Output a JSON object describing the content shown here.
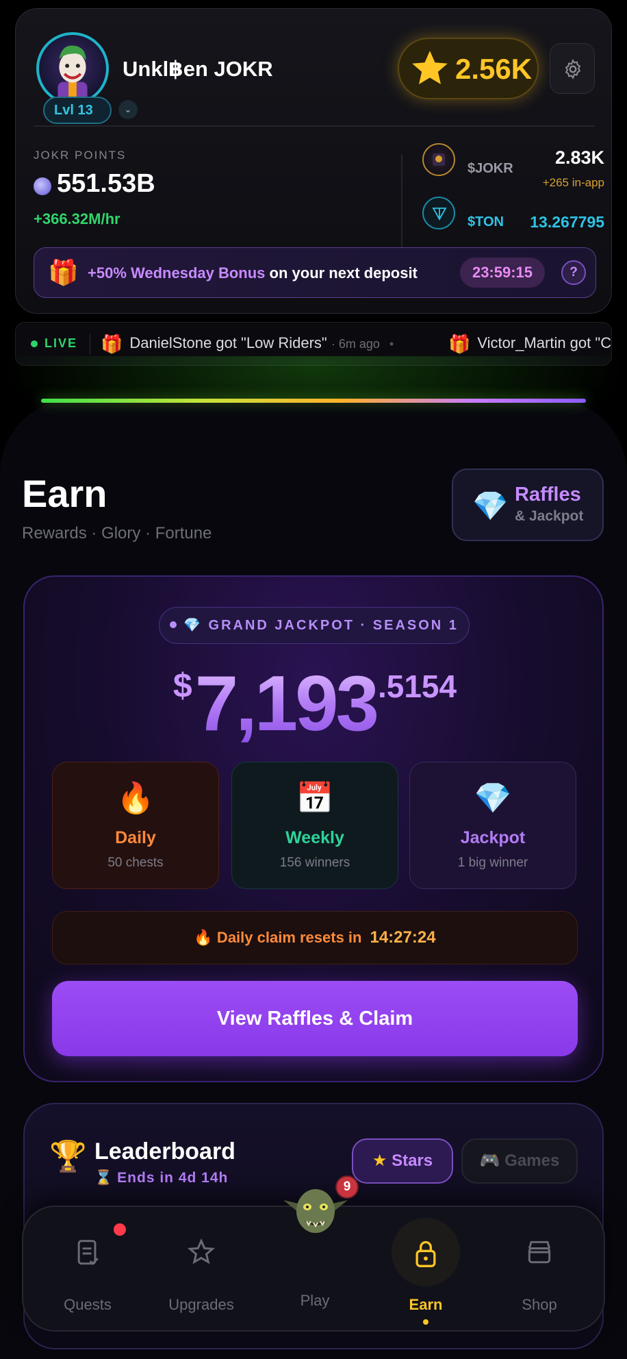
{
  "profile": {
    "username": "Unkl฿en JOKR",
    "level": "Lvl 13",
    "stars_balance": "2.56K"
  },
  "points": {
    "label": "JOKR POINTS",
    "value": "551.53B",
    "rate": "+366.32M/hr"
  },
  "wallet": {
    "jokr_label": "$JOKR",
    "jokr_value": "2.83K",
    "jokr_sub": "+265 in-app",
    "ton_label": "$TON",
    "ton_value": "13.267795"
  },
  "bonus": {
    "highlight": "+50% Wednesday Bonus",
    "rest": "on your next deposit",
    "timer": "23:59:15",
    "help": "?"
  },
  "ticker": {
    "live_label": "LIVE",
    "items": [
      {
        "text": "DanielStone got \"Low Riders\"",
        "ago": "· 6m ago"
      },
      {
        "text": "Victor_Martin got \"C",
        "ago": ""
      }
    ]
  },
  "earn": {
    "title": "Earn",
    "subtitle": "Rewards · Glory · Fortune",
    "raffles_title": "Raffles",
    "raffles_sub": "& Jackpot"
  },
  "jackpot": {
    "season_label": "GRAND JACKPOT · SEASON 1",
    "currency": "$",
    "amount_int": "7,193",
    "amount_dec": ".5154",
    "tiers": [
      {
        "icon": "🔥",
        "name": "Daily",
        "desc": "50 chests"
      },
      {
        "icon": "📅",
        "name": "Weekly",
        "desc": "156 winners"
      },
      {
        "icon": "💎",
        "name": "Jackpot",
        "desc": "1 big winner"
      }
    ],
    "reset_label": "🔥 Daily claim resets in",
    "reset_timer": "14:27:24",
    "claim_button": "View Raffles & Claim"
  },
  "leaderboard": {
    "title": "Leaderboard",
    "ends": "Ends in 4d 14h",
    "tab_stars": "Stars",
    "tab_games": "Games"
  },
  "nav": {
    "quests": "Quests",
    "upgrades": "Upgrades",
    "play": "Play",
    "play_badge": "9",
    "earn": "Earn",
    "shop": "Shop"
  },
  "colors": {
    "accent_purple": "#9c4cf4",
    "gold": "#ffc626",
    "green": "#33d46b",
    "ton_blue": "#2fc4e4"
  }
}
